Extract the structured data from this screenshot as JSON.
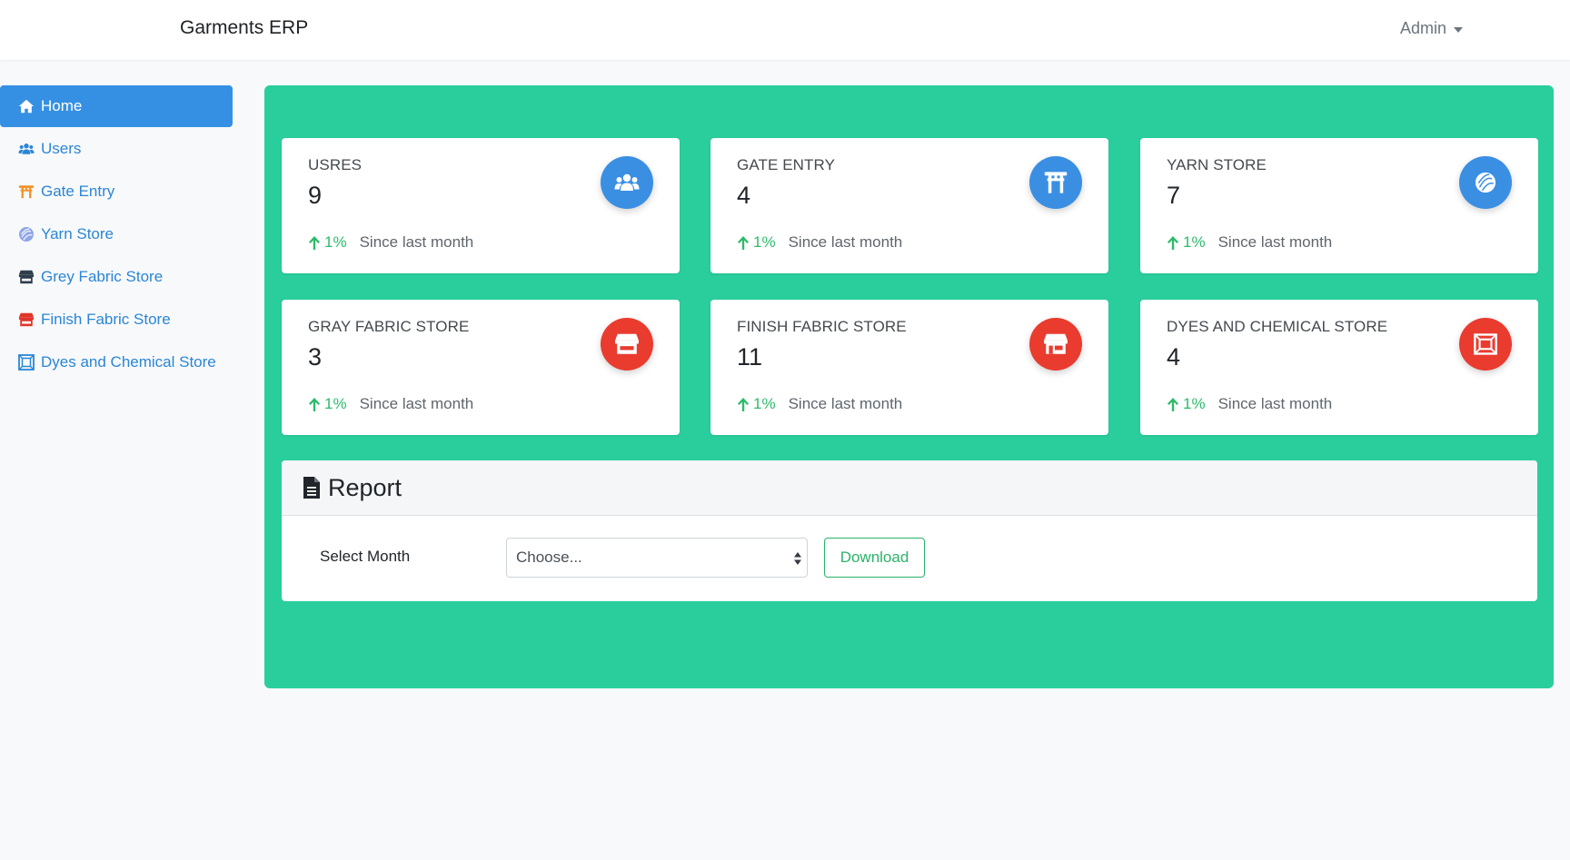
{
  "app": {
    "brand": "Garments ERP",
    "user": "Admin"
  },
  "sidebar": {
    "items": [
      {
        "label": "Home",
        "icon": "home-icon",
        "active": true,
        "color": "#ffffff"
      },
      {
        "label": "Users",
        "icon": "users-icon",
        "color": "#2a86d6"
      },
      {
        "label": "Gate Entry",
        "icon": "torii-gate-icon",
        "color": "#f0932b"
      },
      {
        "label": "Yarn Store",
        "icon": "yarn-icon",
        "color": "#8fa7e8"
      },
      {
        "label": "Grey Fabric Store",
        "icon": "store-icon",
        "color": "#2f3e4c"
      },
      {
        "label": "Finish Fabric Store",
        "icon": "store-icon",
        "color": "#e0352b"
      },
      {
        "label": "Dyes and Chemical Store",
        "icon": "canvas-icon",
        "color": "#2a86d6"
      }
    ]
  },
  "cards": [
    {
      "title": "USRES",
      "value": "9",
      "trend": "1%",
      "trend_text": "Since last month",
      "icon": "users-icon",
      "icon_bg": "#3a8fe3"
    },
    {
      "title": "GATE ENTRY",
      "value": "4",
      "trend": "1%",
      "trend_text": "Since last month",
      "icon": "torii-gate-icon",
      "icon_bg": "#3a8fe3"
    },
    {
      "title": "YARN STORE",
      "value": "7",
      "trend": "1%",
      "trend_text": "Since last month",
      "icon": "yarn-icon",
      "icon_bg": "#3a8fe3"
    },
    {
      "title": "GRAY FABRIC STORE",
      "value": "3",
      "trend": "1%",
      "trend_text": "Since last month",
      "icon": "store-icon",
      "icon_bg": "#ea3b2f"
    },
    {
      "title": "FINISH FABRIC STORE",
      "value": "11",
      "trend": "1%",
      "trend_text": "Since last month",
      "icon": "store-icon",
      "icon_bg": "#ea3b2f"
    },
    {
      "title": "DYES AND CHEMICAL STORE",
      "value": "4",
      "trend": "1%",
      "trend_text": "Since last month",
      "icon": "canvas-icon",
      "icon_bg": "#ea3b2f"
    }
  ],
  "report": {
    "title": "Report",
    "month_label": "Select Month",
    "select_value": "Choose...",
    "download_label": "Download"
  },
  "colors": {
    "panel": "#2ace9d",
    "accent": "#3590e3",
    "trend": "#2dbb6a"
  }
}
